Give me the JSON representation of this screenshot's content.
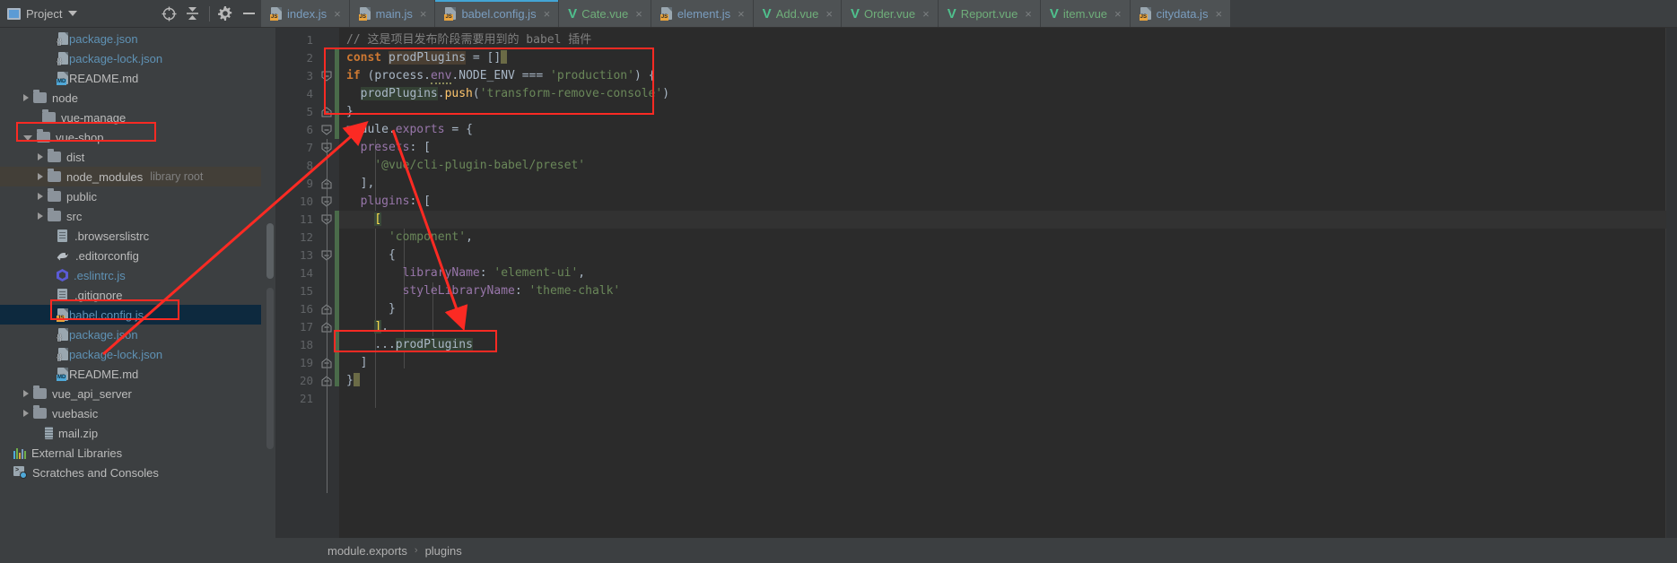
{
  "toolbar": {
    "project_label": "Project",
    "icons": [
      "project-window-icon",
      "caret-down-icon",
      "locate-target-icon",
      "collapse-all-icon",
      "gear-icon",
      "minimize-icon"
    ]
  },
  "tabs": [
    {
      "label": "index.js",
      "icon": "js-file-icon",
      "kind": "js",
      "active": false,
      "close": "×"
    },
    {
      "label": "main.js",
      "icon": "js-file-icon",
      "kind": "js",
      "active": false,
      "close": "×"
    },
    {
      "label": "babel.config.js",
      "icon": "js-file-icon",
      "kind": "js",
      "active": true,
      "close": "×"
    },
    {
      "label": "Cate.vue",
      "icon": "vue-file-icon",
      "kind": "vue",
      "active": false,
      "close": "×"
    },
    {
      "label": "element.js",
      "icon": "js-file-icon",
      "kind": "js",
      "active": false,
      "close": "×"
    },
    {
      "label": "Add.vue",
      "icon": "vue-file-icon",
      "kind": "vue",
      "active": false,
      "close": "×"
    },
    {
      "label": "Order.vue",
      "icon": "vue-file-icon",
      "kind": "vue",
      "active": false,
      "close": "×"
    },
    {
      "label": "Report.vue",
      "icon": "vue-file-icon",
      "kind": "vue",
      "active": false,
      "close": "×"
    },
    {
      "label": "item.vue",
      "icon": "vue-file-icon",
      "kind": "vue",
      "active": false,
      "close": "×"
    },
    {
      "label": "citydata.js",
      "icon": "js-file-icon",
      "kind": "js",
      "active": false,
      "close": "×"
    }
  ],
  "tree": [
    {
      "label": "package.json",
      "sub": "",
      "indent": 3,
      "arrow": "none",
      "icon": "json-file-icon",
      "color": "blue",
      "state": ""
    },
    {
      "label": "package-lock.json",
      "sub": "",
      "indent": 3,
      "arrow": "none",
      "icon": "json-file-icon",
      "color": "blue",
      "state": ""
    },
    {
      "label": "README.md",
      "sub": "",
      "indent": 3,
      "arrow": "none",
      "icon": "md-file-icon",
      "color": "plain",
      "state": ""
    },
    {
      "label": "node",
      "sub": "",
      "indent": 1,
      "arrow": "right",
      "icon": "folder-icon",
      "color": "plain",
      "state": ""
    },
    {
      "label": "vue-manage",
      "sub": "",
      "indent": 2,
      "arrow": "none",
      "icon": "folder-icon",
      "color": "plain",
      "state": ""
    },
    {
      "label": "vue-shop",
      "sub": "",
      "indent": 1,
      "arrow": "down",
      "icon": "folder-icon",
      "color": "plain",
      "state": ""
    },
    {
      "label": "dist",
      "sub": "",
      "indent": 2,
      "arrow": "right",
      "icon": "folder-icon",
      "color": "plain",
      "state": ""
    },
    {
      "label": "node_modules",
      "sub": "library root",
      "indent": 2,
      "arrow": "right",
      "icon": "folder-icon",
      "color": "plain",
      "state": "lib"
    },
    {
      "label": "public",
      "sub": "",
      "indent": 2,
      "arrow": "right",
      "icon": "folder-icon",
      "color": "plain",
      "state": ""
    },
    {
      "label": "src",
      "sub": "",
      "indent": 2,
      "arrow": "right",
      "icon": "folder-icon",
      "color": "plain",
      "state": ""
    },
    {
      "label": ".browserslistrc",
      "sub": "",
      "indent": 3,
      "arrow": "none",
      "icon": "doc-file-icon",
      "color": "plain",
      "state": ""
    },
    {
      "label": ".editorconfig",
      "sub": "",
      "indent": 3,
      "arrow": "none",
      "icon": "editorconfig-icon",
      "color": "plain",
      "state": ""
    },
    {
      "label": ".eslintrc.js",
      "sub": "",
      "indent": 3,
      "arrow": "none",
      "icon": "eslint-icon",
      "color": "blue",
      "state": ""
    },
    {
      "label": ".gitignore",
      "sub": "",
      "indent": 3,
      "arrow": "none",
      "icon": "doc-file-icon",
      "color": "plain",
      "state": ""
    },
    {
      "label": "babel.config.js",
      "sub": "",
      "indent": 3,
      "arrow": "none",
      "icon": "js-file-icon",
      "color": "blue",
      "state": "selected"
    },
    {
      "label": "package.json",
      "sub": "",
      "indent": 3,
      "arrow": "none",
      "icon": "json-file-icon",
      "color": "blue",
      "state": ""
    },
    {
      "label": "package-lock.json",
      "sub": "",
      "indent": 3,
      "arrow": "none",
      "icon": "json-file-icon",
      "color": "blue",
      "state": ""
    },
    {
      "label": "README.md",
      "sub": "",
      "indent": 3,
      "arrow": "none",
      "icon": "md-file-icon",
      "color": "plain",
      "state": ""
    },
    {
      "label": "vue_api_server",
      "sub": "",
      "indent": 1,
      "arrow": "right",
      "icon": "folder-icon",
      "color": "plain",
      "state": ""
    },
    {
      "label": "vuebasic",
      "sub": "",
      "indent": 1,
      "arrow": "right",
      "icon": "folder-icon",
      "color": "plain",
      "state": ""
    },
    {
      "label": "mail.zip",
      "sub": "",
      "indent": 2,
      "arrow": "none",
      "icon": "zip-file-icon",
      "color": "plain",
      "state": ""
    },
    {
      "label": "External Libraries",
      "sub": "",
      "indent": 0,
      "arrow": "none",
      "icon": "libraries-icon",
      "color": "plain",
      "state": ""
    },
    {
      "label": "Scratches and Consoles",
      "sub": "",
      "indent": 0,
      "arrow": "none",
      "icon": "scratches-icon",
      "color": "plain",
      "state": ""
    }
  ],
  "code": {
    "line_numbers": [
      "1",
      "2",
      "3",
      "4",
      "5",
      "6",
      "7",
      "8",
      "9",
      "10",
      "11",
      "12",
      "13",
      "14",
      "15",
      "16",
      "17",
      "18",
      "19",
      "20",
      "21"
    ],
    "lines": [
      "// 这是项目发布阶段需要用到的 babel 插件",
      "const prodPlugins = []",
      "if (process.env.NODE_ENV === 'production') {",
      "  prodPlugins.push('transform-remove-console')",
      "}",
      "module.exports = {",
      "  presets: [",
      "    '@vue/cli-plugin-babel/preset'",
      "  ],",
      "  plugins: [",
      "    [",
      "      'component',",
      "      {",
      "        libraryName: 'element-ui',",
      "        styleLibraryName: 'theme-chalk'",
      "      }",
      "    ],",
      "    ...prodPlugins",
      "  ]",
      "}",
      ""
    ],
    "current_line": 11
  },
  "breadcrumb": {
    "items": [
      "module.exports",
      "plugins"
    ],
    "separator": "›"
  },
  "annotations": {
    "boxes": [
      {
        "name": "const-block-highlight"
      },
      {
        "name": "babel-config-tree-highlight"
      },
      {
        "name": "vue-shop-folder-highlight"
      },
      {
        "name": "prod-plugins-spread-highlight"
      }
    ],
    "arrows": [
      "arrow-to-module-exports",
      "arrow-to-prod-plugins"
    ]
  },
  "colors": {
    "annotation_red": "#fc2a23",
    "accent_blue": "#43a5d5",
    "vue_green": "#4fc08d",
    "selection_blue": "#0d293e"
  }
}
